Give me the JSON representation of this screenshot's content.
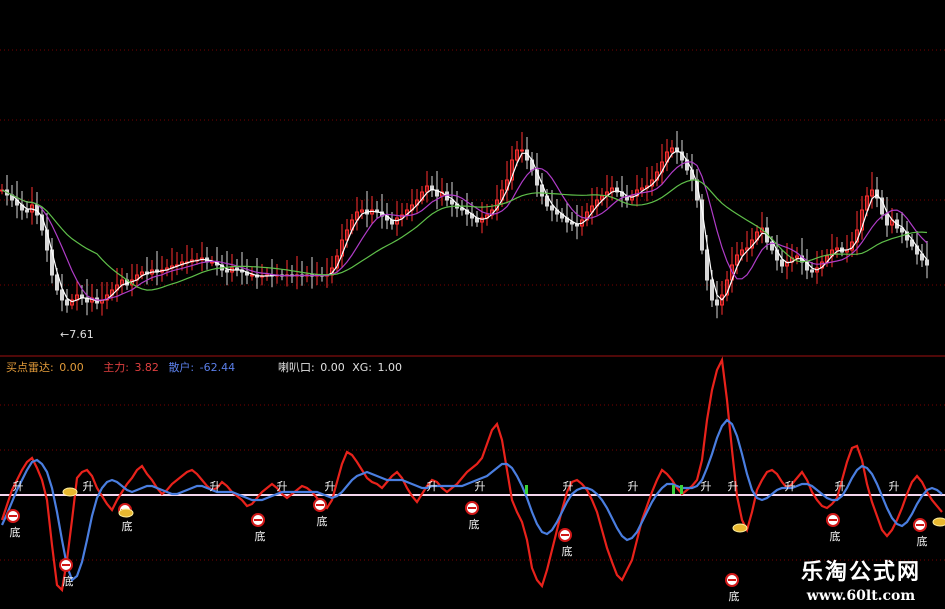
{
  "indicator_header": {
    "buy_radar_label": "买点雷达:",
    "buy_radar_value": "0.00",
    "main_force_label": "主力:",
    "main_force_value": "3.82",
    "retail_label": "散户:",
    "retail_value": "-62.44",
    "horn_label": "喇叭口:",
    "horn_value": "0.00",
    "xg_label": "XG:",
    "xg_value": "1.00"
  },
  "price_annotation": "←7.61",
  "signals": {
    "rise_label": "升",
    "bottom_label": "底"
  },
  "watermark": {
    "title": "乐淘公式网",
    "url": "www.60lt.com"
  },
  "colors": {
    "background": "#000000",
    "red_line": "#e8221b",
    "blue_line": "#4a7ee0",
    "baseline": "#f4d6ee",
    "ma_white": "#ffffff",
    "ma_magenta": "#b03cc8",
    "ma_green": "#5fbf4a",
    "candle_up": "#ff3030",
    "candle_down": "#d8d8d8",
    "grid": "#7a0000",
    "label_orange": "#e09a3a",
    "label_red": "#e04040",
    "label_blue": "#5a7ee8",
    "label_white": "#e0e0e0"
  },
  "chart_data": [
    {
      "type": "candlestick",
      "title": "",
      "x": [
        0,
        5,
        10,
        15,
        20,
        25,
        30,
        35,
        40,
        45,
        50,
        55,
        60,
        65,
        70,
        75,
        80,
        85,
        90,
        95,
        100,
        105,
        110,
        115,
        120,
        125,
        130,
        135,
        140,
        145,
        150,
        155,
        160,
        165,
        170,
        175,
        180,
        185,
        190,
        195,
        200,
        205,
        210,
        215,
        220,
        225,
        230,
        235,
        240,
        245,
        250,
        255,
        260,
        265,
        270,
        275,
        280,
        285,
        290,
        295,
        300,
        305,
        310,
        315,
        320,
        325,
        330,
        335,
        340,
        345,
        350,
        355,
        360,
        365,
        370,
        375,
        380,
        385,
        390,
        395,
        400,
        405,
        410,
        415,
        420,
        425,
        430,
        435,
        440,
        445,
        450,
        455,
        460,
        465,
        470,
        475,
        480,
        485,
        490,
        495,
        500,
        505,
        510,
        515,
        520,
        525,
        530,
        535,
        540,
        545,
        550,
        555,
        560,
        565,
        570,
        575,
        580,
        585,
        590,
        595,
        600,
        605,
        610,
        615,
        620,
        625,
        630,
        635,
        640,
        645,
        650,
        655,
        660,
        665,
        670,
        675,
        680,
        685,
        690,
        695,
        700,
        705,
        710,
        715,
        720,
        725,
        730,
        735,
        740,
        745,
        750,
        755,
        760,
        765,
        770,
        775,
        780,
        785,
        790,
        795,
        800,
        805,
        810,
        815,
        820,
        825,
        830,
        835,
        840,
        845,
        850,
        855,
        860,
        865,
        870,
        875,
        880,
        885,
        890,
        895,
        900,
        905,
        910,
        915,
        920,
        925,
        930,
        935,
        940
      ],
      "price_close": [
        190,
        195,
        200,
        205,
        210,
        212,
        205,
        215,
        230,
        250,
        275,
        290,
        300,
        305,
        300,
        295,
        298,
        302,
        298,
        303,
        300,
        295,
        290,
        285,
        280,
        285,
        280,
        275,
        272,
        274,
        270,
        272,
        270,
        268,
        266,
        265,
        262,
        262,
        260,
        260,
        258,
        262,
        262,
        265,
        270,
        272,
        268,
        270,
        272,
        275,
        275,
        277,
        276,
        275,
        276,
        275,
        276,
        275,
        276,
        275,
        276,
        275,
        276,
        275,
        276,
        275,
        268,
        256,
        240,
        230,
        220,
        212,
        210,
        214,
        210,
        212,
        216,
        220,
        224,
        218,
        215,
        210,
        205,
        200,
        192,
        186,
        190,
        196,
        192,
        200,
        204,
        208,
        210,
        214,
        218,
        222,
        218,
        215,
        210,
        200,
        190,
        180,
        160,
        150,
        150,
        160,
        170,
        185,
        196,
        206,
        210,
        214,
        218,
        222,
        224,
        226,
        220,
        212,
        206,
        200,
        196,
        192,
        188,
        192,
        196,
        200,
        196,
        190,
        188,
        186,
        180,
        172,
        162,
        152,
        148,
        152,
        160,
        170,
        180,
        200,
        250,
        280,
        300,
        305,
        295,
        280,
        265,
        255,
        250,
        248,
        240,
        232,
        228,
        242,
        250,
        260,
        266,
        262,
        258,
        256,
        262,
        270,
        272,
        268,
        262,
        256,
        250,
        248,
        252,
        250,
        242,
        230,
        210,
        196,
        190,
        198,
        214,
        225,
        220,
        228,
        232,
        240,
        246,
        254,
        260,
        265
      ]
    },
    {
      "type": "line",
      "title": "",
      "series": [
        {
          "color": "#e8221b",
          "values": [
            520,
            505,
            490,
            480,
            470,
            462,
            458,
            468,
            480,
            500,
            545,
            585,
            590,
            560,
            520,
            478,
            472,
            470,
            476,
            488,
            496,
            504,
            510,
            500,
            492,
            484,
            478,
            470,
            466,
            474,
            480,
            488,
            494,
            490,
            484,
            480,
            476,
            472,
            470,
            474,
            480,
            486,
            490,
            488,
            482,
            486,
            492,
            496,
            500,
            506,
            504,
            498,
            492,
            488,
            484,
            488,
            494,
            498,
            494,
            490,
            486,
            488,
            492,
            498,
            504,
            508,
            500,
            482,
            464,
            452,
            455,
            462,
            470,
            478,
            482,
            484,
            488,
            482,
            476,
            472,
            478,
            488,
            496,
            502,
            494,
            486,
            480,
            482,
            488,
            492,
            488,
            484,
            478,
            472,
            468,
            464,
            458,
            444,
            430,
            424,
            440,
            470,
            500,
            512,
            522,
            540,
            568,
            580,
            586,
            570,
            550,
            530,
            510,
            492,
            482,
            480,
            484,
            490,
            500,
            512,
            530,
            548,
            562,
            575,
            580,
            570,
            560,
            540,
            520,
            506,
            492,
            480,
            470,
            474,
            480,
            488,
            494,
            490,
            486,
            480,
            460,
            420,
            390,
            370,
            360,
            400,
            450,
            496,
            520,
            530,
            512,
            490,
            480,
            472,
            470,
            474,
            482,
            488,
            484,
            478,
            472,
            480,
            492,
            500,
            506,
            508,
            504,
            498,
            480,
            462,
            448,
            446,
            460,
            484,
            502,
            516,
            530,
            536,
            530,
            520,
            508,
            494,
            482,
            476,
            482,
            492,
            500,
            506,
            512,
            520
          ]
        },
        {
          "color": "#4a7ee0",
          "values": [
            525,
            514,
            502,
            490,
            480,
            470,
            462,
            460,
            464,
            472,
            488,
            512,
            540,
            566,
            580,
            576,
            562,
            540,
            516,
            498,
            488,
            482,
            480,
            482,
            486,
            490,
            492,
            490,
            488,
            486,
            486,
            488,
            490,
            492,
            494,
            494,
            492,
            490,
            488,
            486,
            486,
            488,
            490,
            492,
            492,
            492,
            492,
            494,
            496,
            498,
            500,
            500,
            500,
            498,
            496,
            494,
            492,
            492,
            492,
            492,
            492,
            492,
            492,
            492,
            494,
            496,
            498,
            496,
            492,
            486,
            480,
            476,
            474,
            472,
            474,
            476,
            478,
            480,
            480,
            480,
            480,
            482,
            484,
            486,
            488,
            488,
            486,
            486,
            486,
            486,
            486,
            486,
            486,
            484,
            482,
            480,
            478,
            476,
            472,
            468,
            464,
            464,
            468,
            476,
            486,
            498,
            512,
            524,
            532,
            534,
            530,
            522,
            512,
            502,
            494,
            490,
            488,
            488,
            490,
            494,
            500,
            508,
            518,
            528,
            536,
            540,
            538,
            532,
            522,
            512,
            502,
            494,
            488,
            484,
            484,
            486,
            488,
            488,
            488,
            486,
            480,
            468,
            454,
            438,
            426,
            420,
            424,
            436,
            454,
            474,
            490,
            498,
            500,
            498,
            494,
            490,
            488,
            488,
            488,
            486,
            484,
            484,
            486,
            490,
            494,
            498,
            500,
            500,
            496,
            488,
            478,
            470,
            466,
            468,
            474,
            484,
            496,
            508,
            518,
            524,
            526,
            522,
            514,
            504,
            496,
            490,
            488,
            490,
            494,
            500
          ]
        }
      ],
      "baseline": 495,
      "rise_markers_x": [
        18,
        88,
        215,
        282,
        330,
        432,
        480,
        568,
        633,
        706,
        733,
        790,
        840,
        894
      ],
      "bottom_markers_x": [
        13,
        66,
        125,
        258,
        320,
        472,
        565,
        732,
        833,
        920
      ],
      "bottom_markers_values": [
        516,
        565,
        510,
        520,
        505,
        508,
        535,
        580,
        520,
        525
      ]
    }
  ]
}
